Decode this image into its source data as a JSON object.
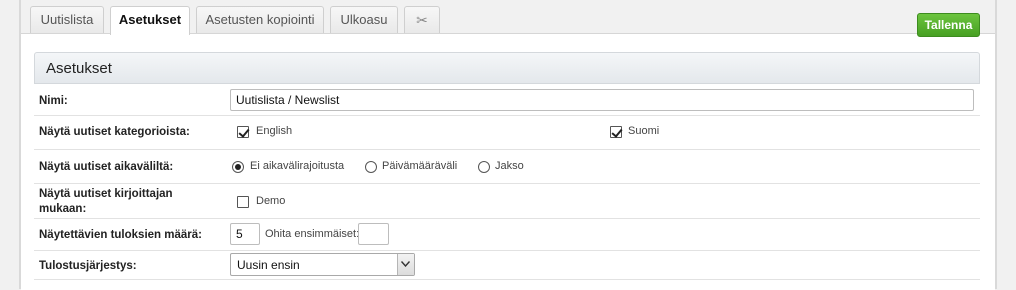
{
  "tabs": [
    {
      "label": "Uutislista",
      "active": false
    },
    {
      "label": "Asetukset",
      "active": true
    },
    {
      "label": "Asetusten kopiointi",
      "active": false
    },
    {
      "label": "Ulkoasu",
      "active": false
    }
  ],
  "tab_extra_icon": "scissors-icon",
  "save_button": {
    "label": "Tallenna",
    "color": "#52ab2a"
  },
  "section": {
    "title": "Asetukset"
  },
  "form": {
    "name": {
      "label": "Nimi:",
      "value": "Uutislista / Newslist"
    },
    "categories": {
      "label": "Näytä uutiset kategorioista:",
      "options": [
        {
          "label": "English",
          "checked": true
        },
        {
          "label": "Suomi",
          "checked": true
        }
      ]
    },
    "timespan": {
      "label": "Näytä uutiset aikaväliltä:",
      "options": [
        {
          "label": "Ei aikavälirajoitusta",
          "selected": true
        },
        {
          "label": "Päivämääräväli",
          "selected": false
        },
        {
          "label": "Jakso",
          "selected": false
        }
      ]
    },
    "author": {
      "label_line1": "Näytä uutiset kirjoittajan",
      "label_line2": "mukaan:",
      "options": [
        {
          "label": "Demo",
          "checked": false
        }
      ]
    },
    "result_count": {
      "label": "Näytettävien tuloksien määrä:",
      "value": "5",
      "skip_label": "Ohita ensimmäiset:",
      "skip_value": ""
    },
    "order": {
      "label": "Tulostusjärjestys:",
      "value": "Uusin ensin"
    }
  }
}
